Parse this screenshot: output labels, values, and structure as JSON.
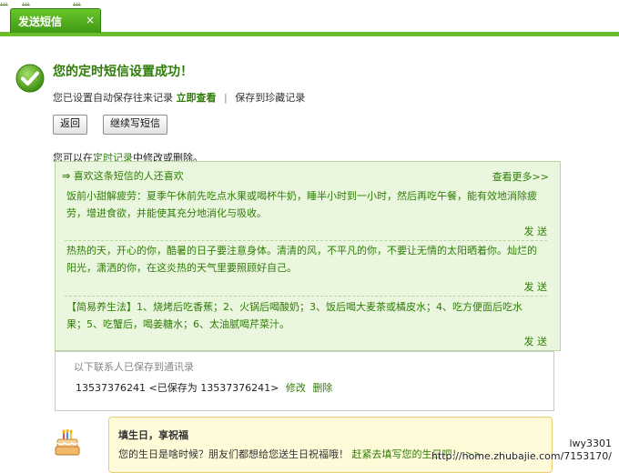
{
  "top_links": [
    "...",
    "...",
    "..."
  ],
  "tab": {
    "label": "发送短信",
    "close": "×"
  },
  "success": {
    "title": "您的定时短信设置成功！",
    "saved_prefix": "您已设置自动保存往来记录",
    "view_now": "立即查看",
    "separator": "|",
    "save_to_favorites": "保存到珍藏记录"
  },
  "buttons": {
    "back": "返回",
    "continue": "继续写短信"
  },
  "note": {
    "prefix": "您可以在",
    "link": "定时记录",
    "suffix": "中修改或删除。"
  },
  "recommend": {
    "arrow": "⇒",
    "title": "喜欢这条短信的人还喜欢",
    "more": "查看更多>>",
    "items": [
      {
        "text": "饭前小甜解疲劳：夏季午休前先吃点水果或喝杯牛奶，睡半小时到一小时，然后再吃午餐，能有效地消除疲劳，增进食欲，并能使其充分地消化与吸收。",
        "send": "发 送"
      },
      {
        "text": "热热的天，开心的你，酷暑的日子要注意身体。清清的风，不平凡的你，不要让无情的太阳晒着你。灿烂的阳光，潇洒的你，在这炎热的天气里要照顾好自己。",
        "send": "发 送"
      },
      {
        "text": "【简易养生法】1、烧烤后吃香蕉；2、火锅后喝酸奶；3、饭后喝大麦茶或橘皮水；4、吃方便面后吃水果；5、吃蟹后，喝姜糖水；6、太油腻喝芹菜汁。",
        "send": "发 送"
      }
    ]
  },
  "contacts": {
    "header": "以下联系人已保存到通讯录",
    "row": "13537376241 <已保存为 13537376241>",
    "edit": "修改",
    "delete": "删除"
  },
  "birthday": {
    "title": "填生日，享祝福",
    "text": "您的生日是啥时候？朋友们都想给您送生日祝福哦！",
    "link": "赶紧去填写您的生日吧！ >>"
  },
  "watermark": {
    "user": "lwy3301",
    "url": "http://home.zhubajie.com/7153170/"
  },
  "colors": {
    "accent_green": "#2e7d06",
    "tab_green": "#4aa51a",
    "panel_bg": "#eaf6dd",
    "notice_bg": "#fffbd9"
  }
}
